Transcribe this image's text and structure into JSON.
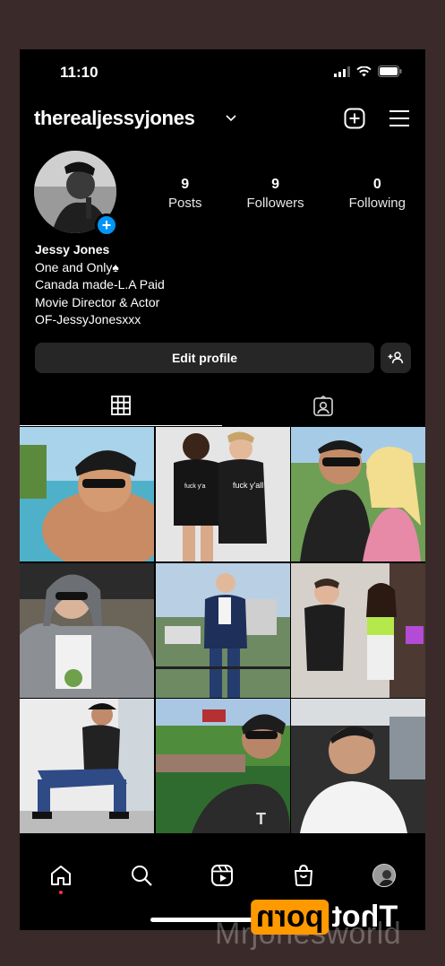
{
  "status_bar": {
    "time": "11:10",
    "icons": [
      "signal-icon",
      "wifi-icon",
      "battery-icon"
    ]
  },
  "header": {
    "username": "therealjessyjones",
    "icons": [
      "chevron-down-icon",
      "create-post-icon",
      "menu-icon"
    ]
  },
  "profile": {
    "stats": [
      {
        "value": "9",
        "label": "Posts"
      },
      {
        "value": "9",
        "label": "Followers"
      },
      {
        "value": "0",
        "label": "Following"
      }
    ],
    "name": "Jessy Jones",
    "bio_lines": [
      "One and Only♠",
      "Canada made-L.A Paid",
      "Movie Director & Actor",
      "OF-JessyJonesxxx"
    ]
  },
  "actions": {
    "edit_label": "Edit profile",
    "discover_icon": "add-person-icon"
  },
  "tabs": [
    {
      "icon": "grid-icon",
      "active": true
    },
    {
      "icon": "tagged-icon",
      "active": false
    }
  ],
  "grid_posts": [
    {
      "theme": "poolside selfie",
      "colors": [
        "#7ab9d6",
        "#c98b63"
      ]
    },
    {
      "theme": "two people fuck y'all shirts",
      "colors": [
        "#dcdcdc",
        "#1a1a1a"
      ]
    },
    {
      "theme": "selfie with blonde",
      "colors": [
        "#5d8a4a",
        "#e4b89c"
      ]
    },
    {
      "theme": "hoodie selfie",
      "colors": [
        "#8c8f93",
        "#d9c3b0"
      ]
    },
    {
      "theme": "balcony suit",
      "colors": [
        "#a9c2da",
        "#1e2f5a"
      ]
    },
    {
      "theme": "dance with woman",
      "colors": [
        "#c7c0ba",
        "#b5e84a"
      ]
    },
    {
      "theme": "chair pose",
      "colors": [
        "#e6e6e6",
        "#2f4b86"
      ]
    },
    {
      "theme": "stadium selfie",
      "colors": [
        "#4f8c3c",
        "#2b2b2b"
      ]
    },
    {
      "theme": "car selfie",
      "colors": [
        "#3a3a3a",
        "#f3f3f3"
      ]
    }
  ],
  "bottom_nav": {
    "items": [
      "home-icon",
      "search-icon",
      "reels-icon",
      "shop-icon",
      "profile-avatar"
    ]
  },
  "watermark": {
    "logo_plain": "Thot",
    "logo_boxed": "porn",
    "text": "Mrjonesworld"
  }
}
